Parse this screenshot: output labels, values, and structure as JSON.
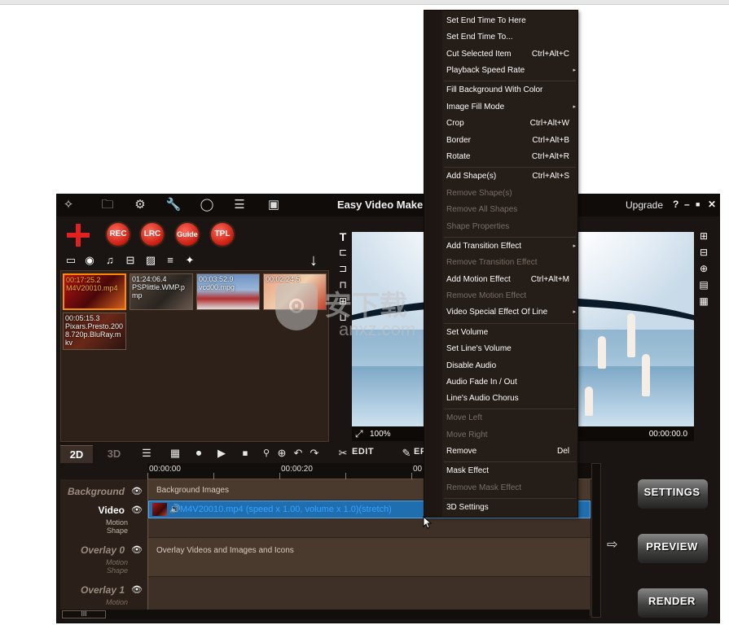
{
  "app": {
    "title": "Easy Video Make",
    "upgrade": "Upgrade",
    "window_controls": {
      "help": "?",
      "minimize": "–",
      "maximize": "■",
      "close": "✕"
    },
    "top_icons": [
      "magic-wand-icon",
      "folder-icon",
      "gear-icon",
      "wrench-icon",
      "chat-icon",
      "database-icon",
      "screen-icon"
    ]
  },
  "toolbar": {
    "add_symbol": "+",
    "buttons": [
      "REC",
      "LRC",
      "Guide",
      "TPL"
    ]
  },
  "media": {
    "thumbs": [
      {
        "caption_line1": "00:17:25.2",
        "caption_line2": "M4V20010.mp4"
      },
      {
        "caption_line1": "01:24:06.4",
        "caption_line2": "PSPlittle.WMP.p",
        "caption_line3": "mp"
      },
      {
        "caption_line1": "00:03:52.9",
        "caption_line2": "vcd00.mpg"
      },
      {
        "caption_line1": "00:02:24.5",
        "caption_line2": ""
      },
      {
        "caption_line1": "00:05:15.3",
        "caption_line2": "Pixars.Presto.200",
        "caption_line3": "8.720p.BluRay.m",
        "caption_line4": "kv"
      }
    ]
  },
  "preview": {
    "zoom": "100%",
    "time": "00:00:00.0"
  },
  "timeline": {
    "tab_2d": "2D",
    "tab_3d": "3D",
    "edit_label": "EDIT",
    "edit2_label": "EF",
    "ruler": [
      "00:00:00",
      "00:00:20",
      "00"
    ],
    "tracks": [
      {
        "name": "Background",
        "sub": ""
      },
      {
        "name": "Video",
        "sub1": "Motion",
        "sub2": "Shape"
      },
      {
        "name": "Overlay 0",
        "sub1": "Motion",
        "sub2": "Shape"
      },
      {
        "name": "Overlay 1",
        "sub1": "Motion",
        "sub2": ""
      }
    ],
    "background_row": "Background Images",
    "video_clip": "M4V20010.mp4  (speed x 1.00, volume x 1.0)(stretch)",
    "overlay_row": "Overlay Videos and Images and Icons",
    "scroll_thumb": "III"
  },
  "side_buttons": {
    "settings": "SETTINGS",
    "preview": "PREVIEW",
    "render": "RENDER"
  },
  "context_menu": [
    {
      "label": "Set End Time To Here",
      "shortcut": "",
      "disabled": false
    },
    {
      "label": "Set End Time To...",
      "shortcut": "",
      "disabled": false
    },
    {
      "label": "Cut Selected Item",
      "shortcut": "Ctrl+Alt+C",
      "disabled": false
    },
    {
      "label": "Playback Speed Rate",
      "shortcut": "",
      "submenu": "▸",
      "disabled": false
    },
    {
      "label": "Fill Background With Color",
      "shortcut": "",
      "disabled": false
    },
    {
      "label": "Image Fill Mode",
      "shortcut": "",
      "submenu": "▸",
      "disabled": false
    },
    {
      "label": "Crop",
      "shortcut": "Ctrl+Alt+W",
      "disabled": false
    },
    {
      "label": "Border",
      "shortcut": "Ctrl+Alt+B",
      "disabled": false
    },
    {
      "label": "Rotate",
      "shortcut": "Ctrl+Alt+R",
      "disabled": false
    },
    {
      "label": "Add Shape(s)",
      "shortcut": "Ctrl+Alt+S",
      "disabled": false
    },
    {
      "label": "Remove Shape(s)",
      "shortcut": "",
      "disabled": true
    },
    {
      "label": "Remove All Shapes",
      "shortcut": "",
      "disabled": true
    },
    {
      "label": "Shape Properties",
      "shortcut": "",
      "disabled": true
    },
    {
      "label": "Add Transition Effect",
      "shortcut": "",
      "submenu": "▸",
      "disabled": false
    },
    {
      "label": "Remove Transition Effect",
      "shortcut": "",
      "disabled": true
    },
    {
      "label": "Add Motion Effect",
      "shortcut": "Ctrl+Alt+M",
      "disabled": false
    },
    {
      "label": "Remove Motion Effect",
      "shortcut": "",
      "disabled": true
    },
    {
      "label": "Video Special Effect Of Line",
      "shortcut": "",
      "submenu": "▸",
      "disabled": false
    },
    {
      "label": "Set Volume",
      "shortcut": "",
      "disabled": false
    },
    {
      "label": "Set Line's Volume",
      "shortcut": "",
      "disabled": false
    },
    {
      "label": "Disable Audio",
      "shortcut": "",
      "disabled": false
    },
    {
      "label": "Audio Fade In / Out",
      "shortcut": "",
      "disabled": false
    },
    {
      "label": "Line's Audio Chorus",
      "shortcut": "",
      "disabled": false
    },
    {
      "label": "Move Left",
      "shortcut": "",
      "disabled": true
    },
    {
      "label": "Move Right",
      "shortcut": "",
      "disabled": true
    },
    {
      "label": "Remove",
      "shortcut": "Del",
      "disabled": false
    },
    {
      "label": "Mask Effect",
      "shortcut": "",
      "disabled": false
    },
    {
      "label": "Remove Mask Effect",
      "shortcut": "",
      "disabled": true
    },
    {
      "label": "3D Settings",
      "shortcut": "",
      "disabled": false
    }
  ],
  "watermark": {
    "cn": "安下载",
    "en": "anxz.com"
  },
  "colors": {
    "accent_red": "#e32020",
    "clip_blue": "#1f6fb0",
    "selection_orange": "#ff8a00"
  }
}
